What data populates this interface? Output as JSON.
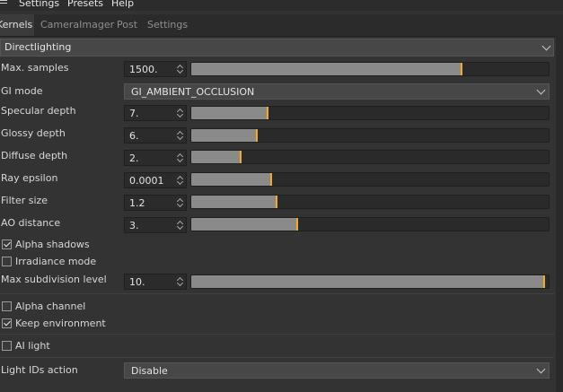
{
  "menu": [
    "Settings",
    "Presets",
    "Help"
  ],
  "tabs": [
    "Kernels",
    "CameraImager",
    "Post",
    "Settings"
  ],
  "section": "Directlighting",
  "params": {
    "max_samples": {
      "label": "Max. samples",
      "value": "1500.",
      "fraction": 0.755
    },
    "gi_mode": {
      "label": "GI mode",
      "value": "GI_AMBIENT_OCCLUSION"
    },
    "specular_depth": {
      "label": "Specular depth",
      "value": "7.",
      "fraction": 0.21
    },
    "glossy_depth": {
      "label": "Glossy depth",
      "value": "6.",
      "fraction": 0.18
    },
    "diffuse_depth": {
      "label": "Diffuse depth",
      "value": "2.",
      "fraction": 0.135
    },
    "ray_epsilon": {
      "label": "Ray epsilon",
      "value": "0.0001",
      "fraction": 0.22
    },
    "filter_size": {
      "label": "Filter size",
      "value": "1.2",
      "fraction": 0.235
    },
    "ao_distance": {
      "label": "AO distance",
      "value": "3.",
      "fraction": 0.295
    },
    "alpha_shadows": {
      "label": "Alpha shadows",
      "checked": true
    },
    "irradiance_mode": {
      "label": "Irradiance mode",
      "checked": false
    },
    "max_subdivision_level": {
      "label": "Max subdivision level",
      "value": "10.",
      "fraction": 0.985
    },
    "alpha_channel": {
      "label": "Alpha channel",
      "checked": false
    },
    "keep_environment": {
      "label": "Keep environment",
      "checked": true
    },
    "ai_light": {
      "label": "AI light",
      "checked": false
    },
    "light_ids_action": {
      "label": "Light IDs action",
      "value": "Disable"
    }
  },
  "colors": {
    "accent": "#f2a92c",
    "fill": "#8a8a8a",
    "background": "#333333"
  }
}
